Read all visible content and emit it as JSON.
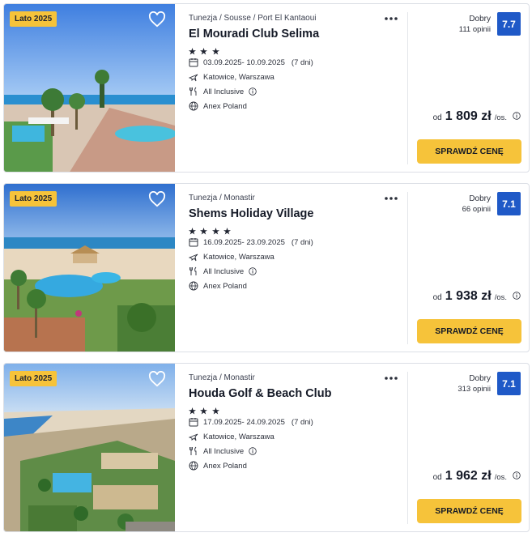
{
  "offers": [
    {
      "badge": "Lato 2025",
      "breadcrumb": "Tunezja / Sousse / Port El Kantaoui",
      "name": "El Mouradi Club Selima",
      "stars": 3,
      "dates": "03.09.2025- 10.09.2025",
      "duration": "(7 dni)",
      "departure": "Katowice, Warszawa",
      "board": "All Inclusive",
      "operator": "Anex Poland",
      "rating_label": "Dobry",
      "reviews": "111 opinii",
      "score": "7.7",
      "price_prefix": "od",
      "price": "1 809 zł",
      "price_suffix": "/os.",
      "cta": "SPRAWDŹ CENĘ"
    },
    {
      "badge": "Lato 2025",
      "breadcrumb": "Tunezja / Monastir",
      "name": "Shems Holiday Village",
      "stars": 4,
      "dates": "16.09.2025- 23.09.2025",
      "duration": "(7 dni)",
      "departure": "Katowice, Warszawa",
      "board": "All Inclusive",
      "operator": "Anex Poland",
      "rating_label": "Dobry",
      "reviews": "66 opinii",
      "score": "7.1",
      "price_prefix": "od",
      "price": "1 938 zł",
      "price_suffix": "/os.",
      "cta": "SPRAWDŹ CENĘ"
    },
    {
      "badge": "Lato 2025",
      "breadcrumb": "Tunezja / Monastir",
      "name": "Houda Golf & Beach Club",
      "stars": 3,
      "dates": "17.09.2025- 24.09.2025",
      "duration": "(7 dni)",
      "departure": "Katowice, Warszawa",
      "board": "All Inclusive",
      "operator": "Anex Poland",
      "rating_label": "Dobry",
      "reviews": "313 opinii",
      "score": "7.1",
      "price_prefix": "od",
      "price": "1 962 zł",
      "price_suffix": "/os.",
      "cta": "SPRAWDŹ CENĘ"
    }
  ],
  "colors": {
    "accent_yellow": "#f6c33a",
    "score_blue": "#1f59c7",
    "text_dark": "#151a27",
    "border": "#dcdfe6"
  },
  "icons": {
    "favorite": "heart-outline-icon",
    "more": "more-dots-icon",
    "star": "star-icon",
    "dates": "calendar-icon",
    "departure": "plane-icon",
    "board": "cutlery-icon",
    "operator": "globe-icon",
    "info": "info-circle-icon"
  }
}
